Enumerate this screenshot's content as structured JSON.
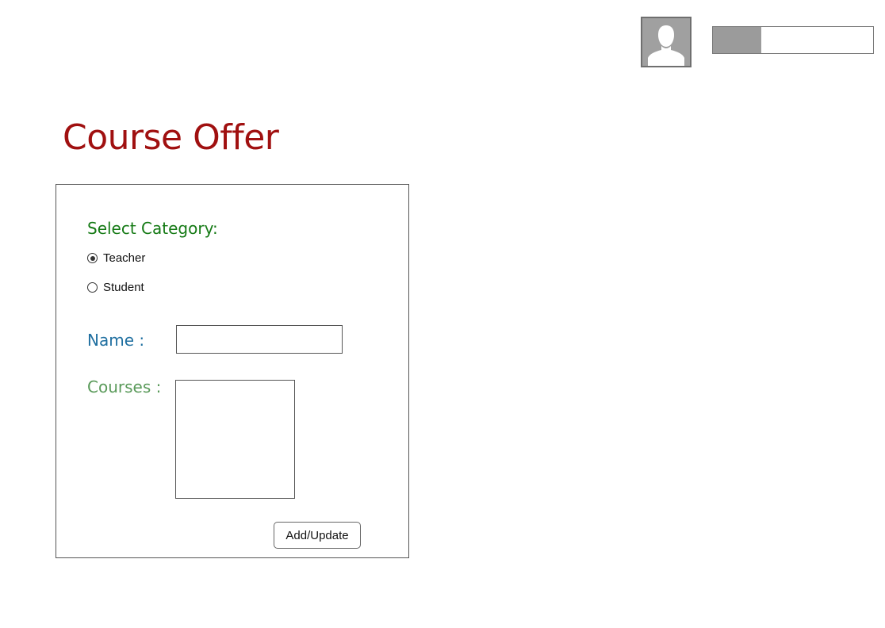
{
  "header": {
    "user_progress_fraction": 0.3
  },
  "page": {
    "title": "Course Offer"
  },
  "form": {
    "category_label": "Select Category:",
    "categories": [
      {
        "label": "Teacher",
        "checked": true
      },
      {
        "label": "Student",
        "checked": false
      }
    ],
    "name_label": "Name :",
    "name_value": "",
    "courses_label": "Courses :",
    "courses_value": "",
    "submit_label": "Add/Update"
  },
  "colors": {
    "title": "#a01010",
    "category_label": "#157a15",
    "name_label": "#1f6fa0",
    "courses_label": "#5a9a5a"
  },
  "icons": {
    "avatar": "user-silhouette-icon"
  }
}
